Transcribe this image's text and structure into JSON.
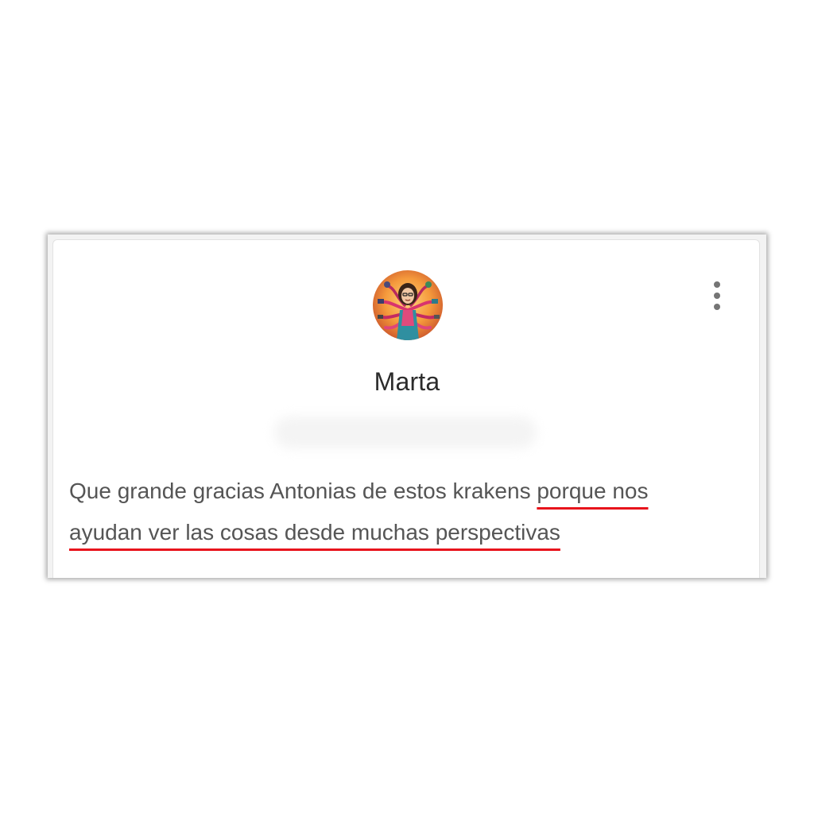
{
  "post": {
    "author": "Marta",
    "comment": {
      "text_plain": "Que grande gracias Antonias de estos krakens ",
      "text_highlighted_line1": "porque nos",
      "text_highlighted_line2": "ayudan ver las cosas desde muchas perspectivas"
    }
  },
  "icons": {
    "menu": "more-vert-icon",
    "avatar": "avatar-image"
  },
  "colors": {
    "highlight_underline": "#e8141c",
    "text": "#555555",
    "name": "#2b2b2b",
    "menu_icon": "#757575"
  }
}
